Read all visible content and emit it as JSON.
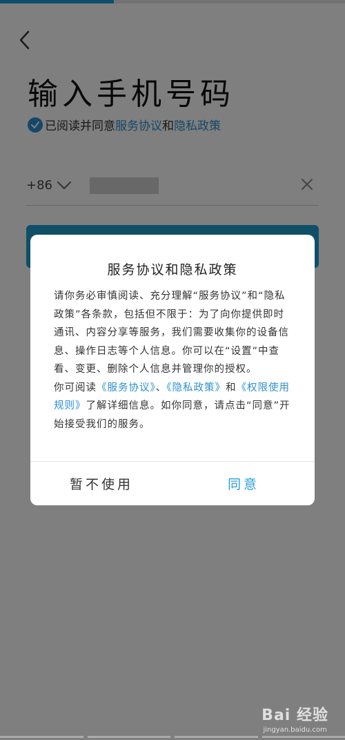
{
  "page": {
    "title": "输入手机号码",
    "progress": 0.33,
    "colors": {
      "accent": "#2a8fd0",
      "button": "#1e9fd0"
    }
  },
  "agreement": {
    "prefix": "已阅读并同意",
    "service_link": "服务协议",
    "and": "和",
    "privacy_link": "隐私政策",
    "checked": true
  },
  "phone": {
    "country_code": "+86",
    "value": ""
  },
  "dialog": {
    "title": "服务协议和隐私政策",
    "paragraph1": "请你务必审慎阅读、充分理解“服务协议”和“隐私政策”各条款，包括但不限于：为了向你提供即时通讯、内容分享等服务，我们需要收集你的设备信息、操作日志等个人信息。你可以在“设置”中查看、变更、删除个人信息并管理你的授权。",
    "p2_prefix": "你可阅读",
    "p2_link1": "《服务协议》",
    "p2_sep": "、",
    "p2_link2": "《隐私政策》",
    "p2_and": "和",
    "p2_link3": "《权限使用规则》",
    "p2_suffix": "了解详细信息。如你同意，请点击“同意”开始接受我们的服务。",
    "decline_label": "暂不使用",
    "agree_label": "同意"
  },
  "watermark": {
    "logo": "Bai 经验",
    "url": "jingyan.baidu.com"
  }
}
